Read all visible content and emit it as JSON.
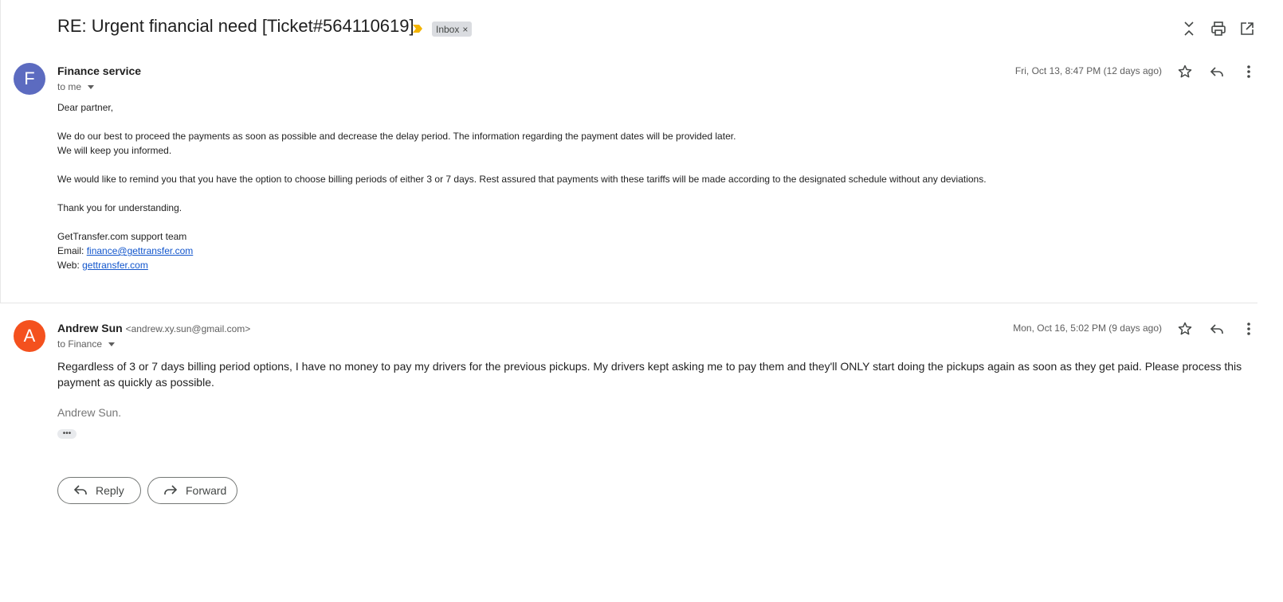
{
  "thread": {
    "subject": "RE: Urgent financial need [Ticket#564110619]",
    "label": "Inbox",
    "label_remove": "×",
    "importance_color": "#f4b400"
  },
  "toolbar": {
    "icons": [
      "collapse-all-icon",
      "print-icon",
      "open-in-new-window-icon"
    ]
  },
  "messages": [
    {
      "avatar_letter": "F",
      "avatar_color": "#5c6bc0",
      "sender_name": "Finance service",
      "recipient": "to me",
      "date": "Fri, Oct 13, 8:47 PM (12 days ago)",
      "body": {
        "greeting": "Dear partner,",
        "para1_line1": "We do our best to proceed the payments as soon as possible and decrease the delay period. The information regarding the payment dates will be provided later.",
        "para1_line2": "We will keep you informed.",
        "para2": "We would like to remind you that you have the option to choose billing periods of either 3 or 7 days. Rest assured that payments with these tariffs will be made according to the designated schedule without any deviations.",
        "para3": "Thank you for understanding.",
        "sig_team": "GetTransfer.com support team",
        "sig_email_label": "Email: ",
        "sig_email": "finance@gettransfer.com",
        "sig_web_label": "Web: ",
        "sig_web": "gettransfer.com"
      }
    },
    {
      "avatar_letter": "A",
      "avatar_color": "#f4511e",
      "sender_name": "Andrew Sun",
      "sender_email": "<andrew.xy.sun@gmail.com>",
      "recipient": "to Finance",
      "date": "Mon, Oct 16, 5:02 PM (9 days ago)",
      "body": "Regardless of 3 or 7 days billing period options, I have no money to pay my drivers for the previous pickups. My drivers kept asking me to pay them and they'll ONLY start doing the pickups again as soon as they get paid. Please process this payment as quickly as possible.",
      "signature": "Andrew Sun.",
      "trimmed_content": "•••"
    }
  ],
  "actions": {
    "reply_label": "Reply",
    "forward_label": "Forward"
  }
}
